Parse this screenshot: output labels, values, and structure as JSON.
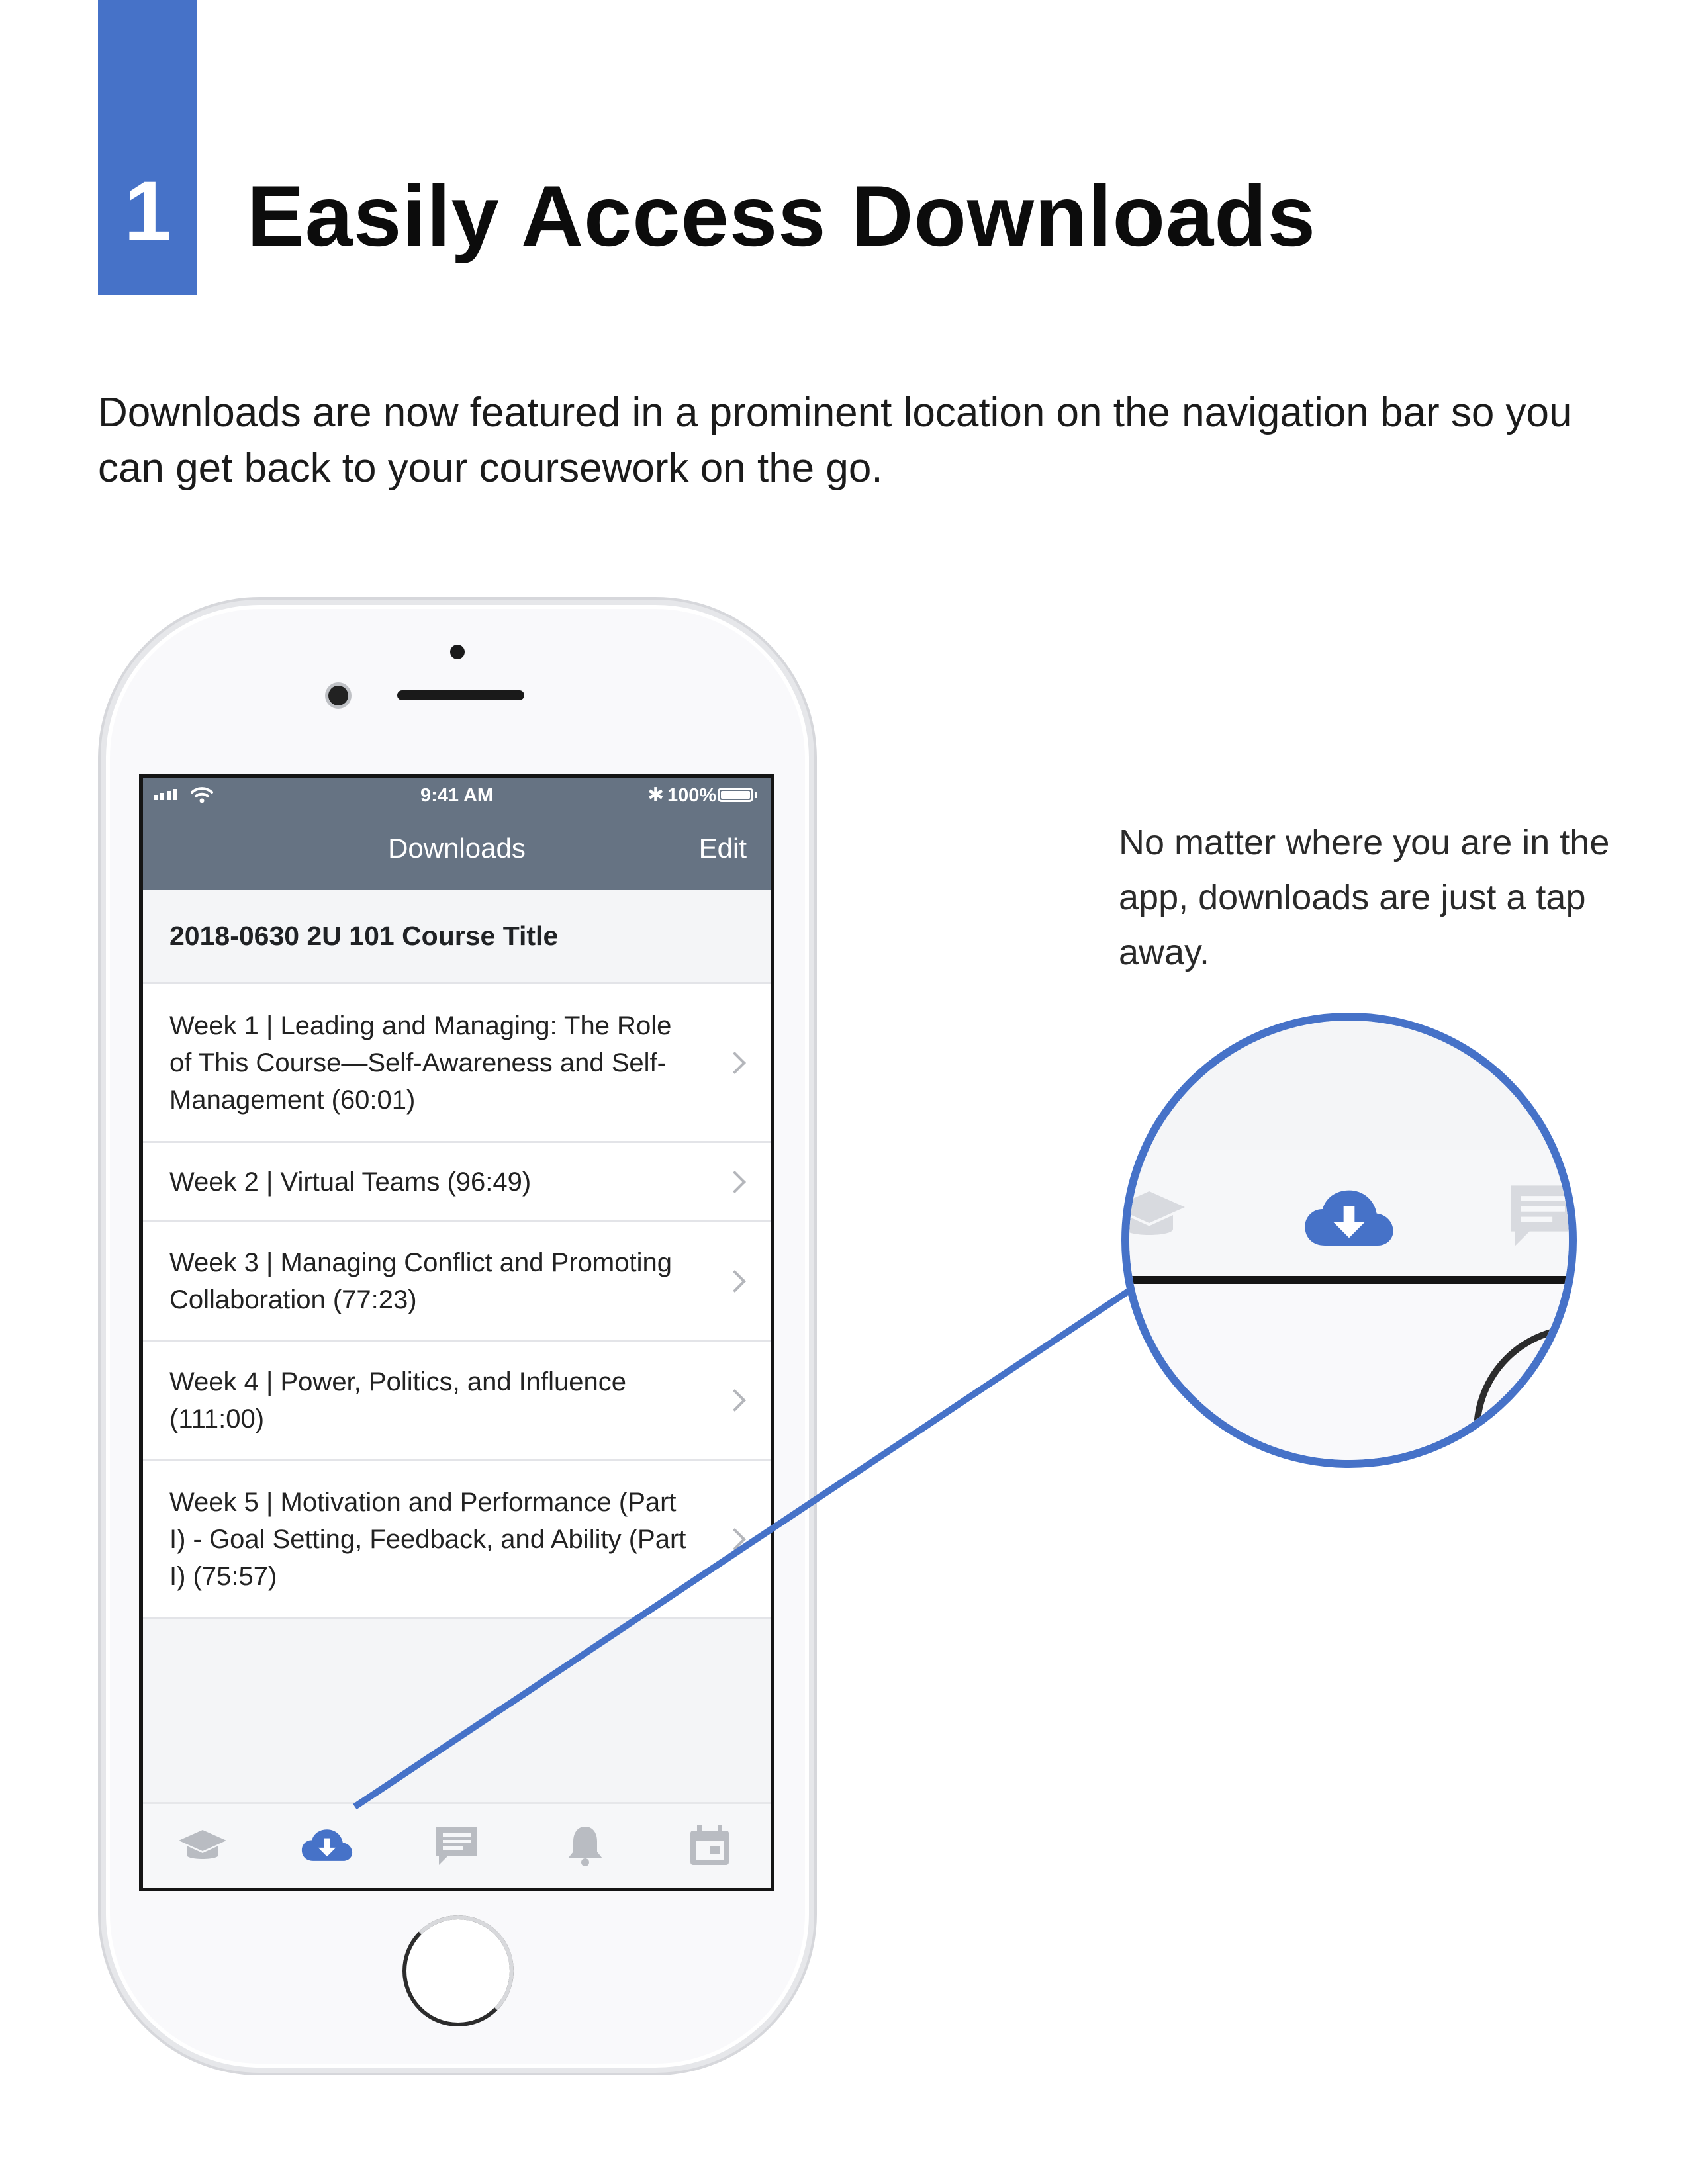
{
  "step": {
    "number": "1",
    "title": "Easily Access Downloads"
  },
  "intro": "Downloads are now featured in a prominent location on the navigation bar so you can get back to your coursework on the go.",
  "side_note": "No matter where you are in the app, downloads are just a tap away.",
  "colors": {
    "accent": "#4672c8",
    "nav_bar": "#667383",
    "icon_inactive": "#b9bcc2"
  },
  "phone": {
    "status_bar": {
      "time": "9:41 AM",
      "battery": "100%",
      "bluetooth_glyph": "✱"
    },
    "nav": {
      "title": "Downloads",
      "edit_label": "Edit"
    },
    "section_title": "2018-0630 2U 101 Course Title",
    "rows": [
      {
        "label": "Week 1 | Leading and Managing: The Role of This Course—Self-Awareness and Self-Management (60:01)"
      },
      {
        "label": "Week 2 | Virtual Teams (96:49)"
      },
      {
        "label": "Week 3 | Managing Conflict and Promoting Collaboration (77:23)"
      },
      {
        "label": "Week 4 | Power, Politics, and Influence (111:00)"
      },
      {
        "label": "Week 5 | Motivation and Performance (Part I) - Goal Setting, Feedback, and Ability (Part I) (75:57)"
      }
    ],
    "tabs": [
      {
        "icon": "graduation-cap-icon",
        "active": false
      },
      {
        "icon": "cloud-download-icon",
        "active": true
      },
      {
        "icon": "chat-icon",
        "active": false
      },
      {
        "icon": "bell-icon",
        "active": false
      },
      {
        "icon": "calendar-icon",
        "active": false
      }
    ]
  }
}
